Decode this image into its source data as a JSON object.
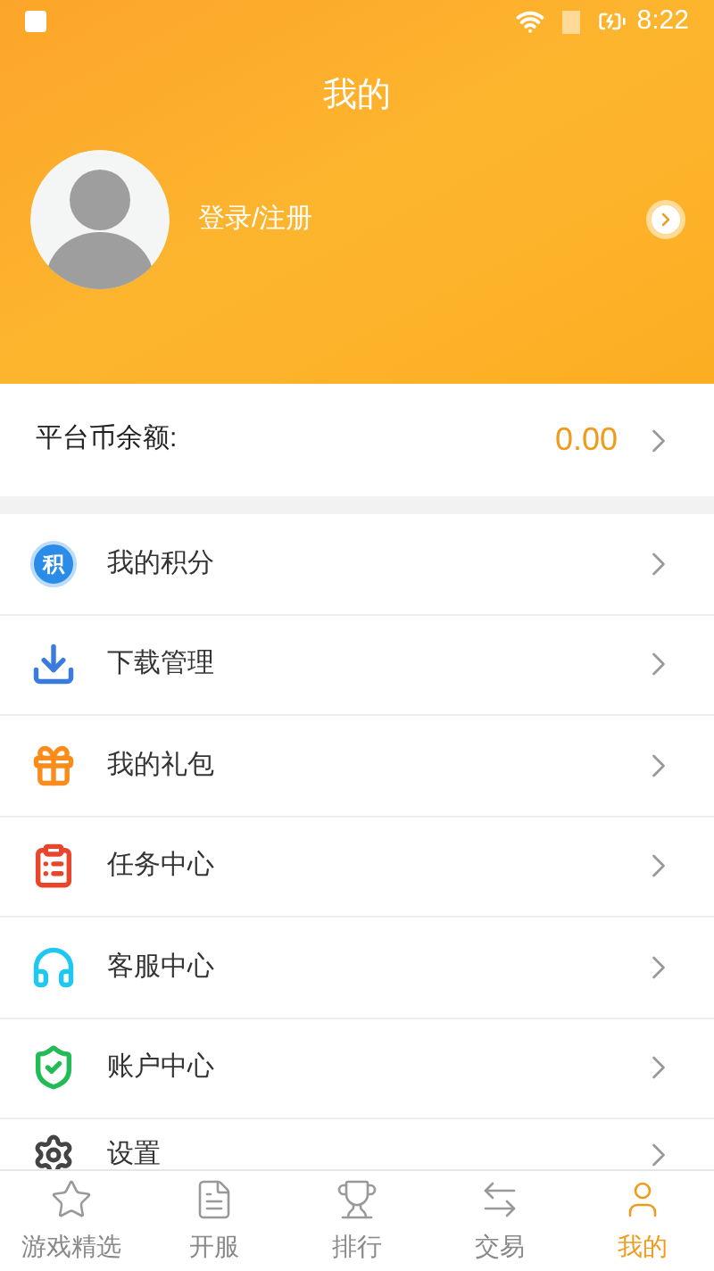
{
  "status_bar": {
    "time": "8:22"
  },
  "header": {
    "title": "我的",
    "login": "登录/注册"
  },
  "balance": {
    "label": "平台币余额:",
    "value": "0.00"
  },
  "menu": [
    {
      "kind": "points",
      "label": "我的积分",
      "icon_text": "积"
    },
    {
      "kind": "download",
      "label": "下载管理"
    },
    {
      "kind": "gift",
      "label": "我的礼包"
    },
    {
      "kind": "task",
      "label": "任务中心"
    },
    {
      "kind": "service",
      "label": "客服中心"
    },
    {
      "kind": "account",
      "label": "账户中心"
    },
    {
      "kind": "settings",
      "label": "设置"
    }
  ],
  "tabs": [
    {
      "kind": "star",
      "label": "游戏精选",
      "selected": false
    },
    {
      "kind": "list",
      "label": "开服",
      "selected": false
    },
    {
      "kind": "trophy",
      "label": "排行",
      "selected": false
    },
    {
      "kind": "trade",
      "label": "交易",
      "selected": false
    },
    {
      "kind": "user",
      "label": "我的",
      "selected": true
    }
  ]
}
